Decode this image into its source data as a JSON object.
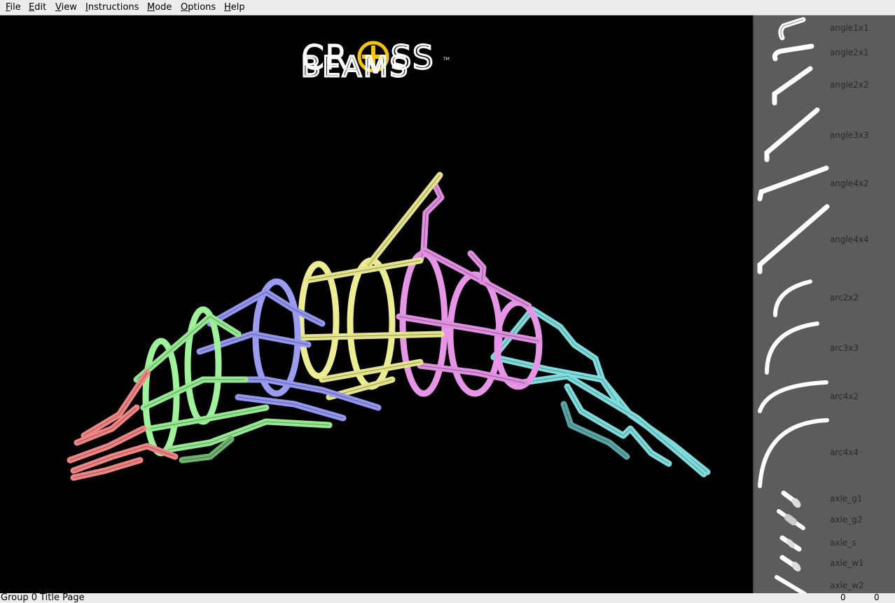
{
  "menubar": {
    "items": [
      "File",
      "Edit",
      "View",
      "Instructions",
      "Mode",
      "Options",
      "Help"
    ]
  },
  "logo": {
    "line1": "CR",
    "line1b": "SS",
    "line2": "BEAMS",
    "tm": "TM"
  },
  "model": {
    "colors": {
      "head": "#f08a8a",
      "front": "#9ef29a",
      "mid_blue": "#9a9cf4",
      "yellow": "#ecec90",
      "pink": "#e895e8",
      "tail": "#8ee6e6"
    }
  },
  "palette": {
    "items": [
      {
        "label": "angle1x1",
        "icon": "angle-piece-icon"
      },
      {
        "label": "angle2x1",
        "icon": "angle-piece-icon"
      },
      {
        "label": "angle2x2",
        "icon": "angle-piece-icon"
      },
      {
        "label": "angle3x3",
        "icon": "angle-piece-icon"
      },
      {
        "label": "angle4x2",
        "icon": "angle-piece-icon"
      },
      {
        "label": "angle4x4",
        "icon": "angle-piece-icon"
      },
      {
        "label": "arc2x2",
        "icon": "arc-piece-icon"
      },
      {
        "label": "arc3x3",
        "icon": "arc-piece-icon"
      },
      {
        "label": "arc4x2",
        "icon": "arc-piece-icon"
      },
      {
        "label": "arc4x4",
        "icon": "arc-piece-icon"
      },
      {
        "label": "axle_g1",
        "icon": "axle-piece-icon"
      },
      {
        "label": "axle_g2",
        "icon": "axle-piece-icon"
      },
      {
        "label": "axle_s",
        "icon": "axle-piece-icon"
      },
      {
        "label": "axle_w1",
        "icon": "axle-piece-icon"
      },
      {
        "label": "axle_w2",
        "icon": "axle-piece-icon"
      }
    ]
  },
  "status": {
    "text": "Group 0 Title Page",
    "x": "0",
    "y": "0"
  }
}
